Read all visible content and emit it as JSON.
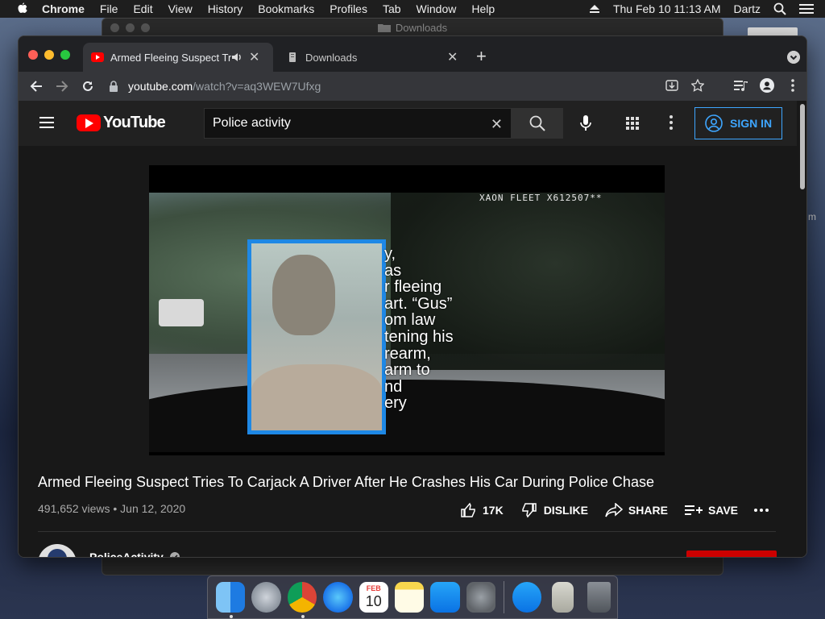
{
  "menubar": {
    "app": "Chrome",
    "items": [
      "File",
      "Edit",
      "View",
      "History",
      "Bookmarks",
      "Profiles",
      "Tab",
      "Window",
      "Help"
    ],
    "clock": "Thu Feb 10  11:13 AM",
    "user": "Dartz"
  },
  "background_window": {
    "title": "Downloads"
  },
  "browser": {
    "tabs": [
      {
        "title": "Armed Fleeing Suspect Tri",
        "active": true,
        "audio": true
      },
      {
        "title": "Downloads",
        "active": false
      }
    ],
    "address": {
      "host": "youtube.com",
      "path": "/watch?v=aq3WEW7Ufxg"
    }
  },
  "youtube": {
    "logo_text": "YouTube",
    "search": {
      "value": "Police activity",
      "placeholder": "Search"
    },
    "signin_label": "SIGN IN",
    "video": {
      "hud_text": "XAON  FLEET  X612507**",
      "overlay_text": "y,\nas\nr fleeing\nart. “Gus”\nom law\ntening his\nrearm,\narm to\nnd\nery"
    },
    "title": "Armed Fleeing Suspect Tries To Carjack A Driver After He Crashes His Car During Police Chase",
    "meta": "491,652 views • Jun 12, 2020",
    "actions": {
      "like": "17K",
      "dislike": "DISLIKE",
      "share": "SHARE",
      "save": "SAVE"
    },
    "channel": {
      "name": "PoliceActivity"
    }
  },
  "dock": {
    "apps": [
      "finder-icon",
      "launchpad-icon",
      "chrome-icon",
      "safari-icon",
      "calendar-icon",
      "notes-icon",
      "app-store-icon",
      "system-preferences-icon",
      "app-store-2-icon",
      "game-emulator-icon",
      "trash-icon"
    ],
    "calendar": {
      "month": "FEB",
      "day": "10"
    }
  },
  "colors": {
    "yt_red": "#ff0000",
    "signin_blue": "#3ea6ff",
    "mug_border": "#1e88e5"
  }
}
